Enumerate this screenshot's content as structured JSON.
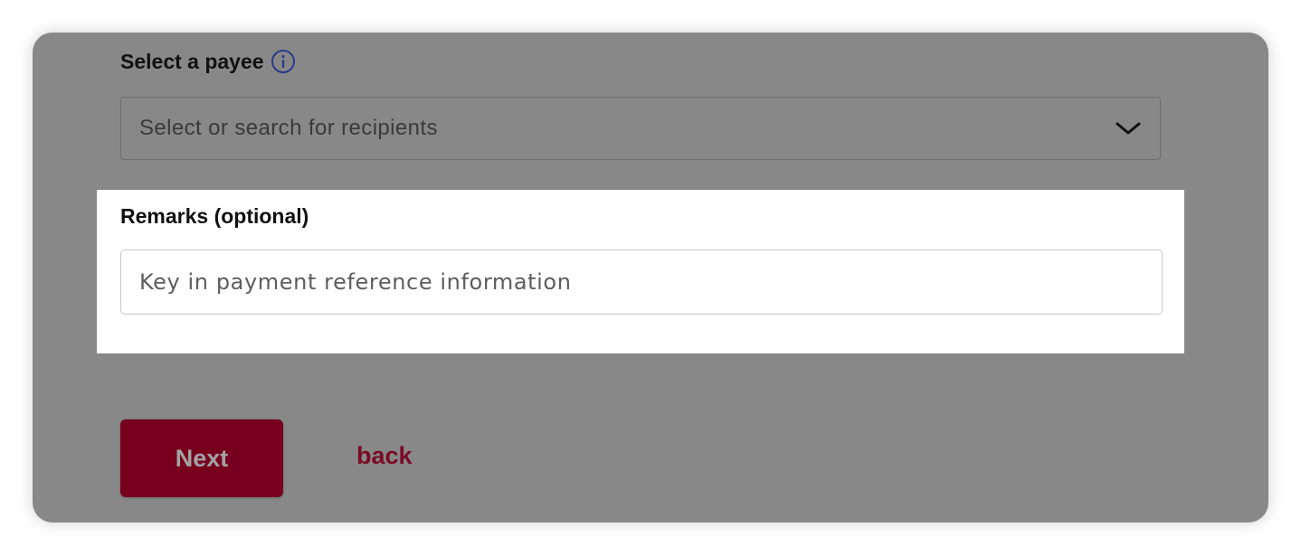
{
  "payee": {
    "label": "Select a payee",
    "info_icon": "info-icon",
    "select_placeholder": "Select or search for recipients",
    "chevron_icon": "chevron-down-icon"
  },
  "remarks": {
    "label": "Remarks (optional)",
    "placeholder": "Key in payment reference information",
    "value": ""
  },
  "actions": {
    "next_label": "Next",
    "back_label": "back"
  },
  "colors": {
    "overlay": "#888888",
    "primary": "#76001d",
    "link": "#7a0a24",
    "info_icon": "#2b3a8c",
    "panel": "#ffffff"
  }
}
